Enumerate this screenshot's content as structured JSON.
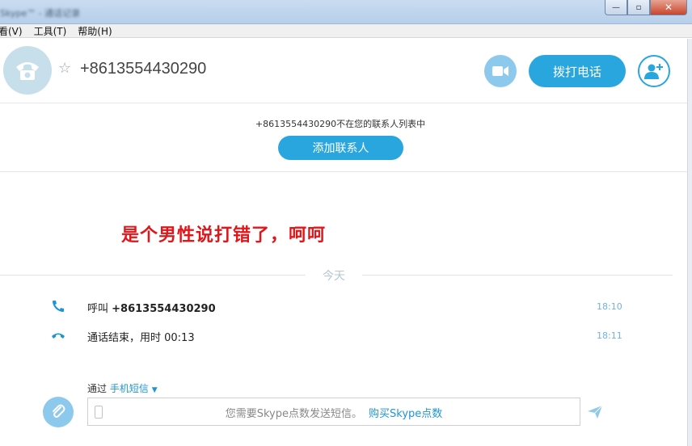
{
  "window": {
    "title": "Skype™ - 通话记录",
    "minimize": "—",
    "maximize": "▫",
    "close": "✕"
  },
  "menu": [
    "看(V)",
    "工具(T)",
    "帮助(H)"
  ],
  "contact": {
    "name": "+8613554430290"
  },
  "header": {
    "call_label": "拨打电话"
  },
  "notice": {
    "text": "+8613554430290不在您的联系人列表中",
    "add_contact_label": "添加联系人"
  },
  "annotation": "是个男性说打错了，呵呵",
  "day_label": "今天",
  "events": [
    {
      "prefix": "呼叫 ",
      "bold": "+8613554430290",
      "time": "18:10",
      "icon": "phone-outgoing-icon"
    },
    {
      "prefix": "通话结束，用时 00:13",
      "bold": "",
      "time": "18:11",
      "icon": "phone-hangup-icon"
    }
  ],
  "compose": {
    "via_label": "通过",
    "via_method": "手机短信",
    "placeholder": "您需要Skype点数发送短信。",
    "buy_link": "购买Skype点数"
  },
  "colors": {
    "accent": "#2aa6de",
    "accent_light": "#8dc9ec",
    "annotation_red": "#e0161b",
    "time_blue": "#6fb4de"
  }
}
